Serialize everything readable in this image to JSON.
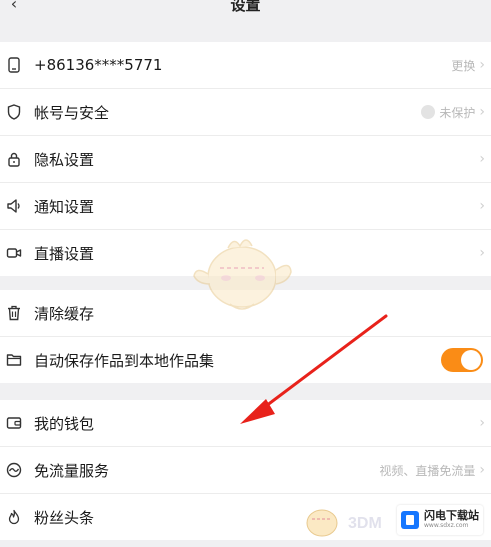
{
  "header": {
    "title": "设置",
    "back_icon": "back-arrow-icon"
  },
  "account_group": {
    "phone": {
      "label": "+86136****5771",
      "action": "更换",
      "icon": "phone-icon"
    },
    "security": {
      "label": "帐号与安全",
      "status": "未保护",
      "icon": "shield-icon"
    },
    "privacy": {
      "label": "隐私设置",
      "icon": "lock-icon"
    },
    "notification": {
      "label": "通知设置",
      "icon": "speaker-icon"
    },
    "live": {
      "label": "直播设置",
      "icon": "video-icon"
    }
  },
  "storage_group": {
    "clear_cache": {
      "label": "清除缓存",
      "icon": "trash-icon"
    },
    "auto_save": {
      "label": "自动保存作品到本地作品集",
      "icon": "folder-icon",
      "enabled": true
    }
  },
  "service_group": {
    "wallet": {
      "label": "我的钱包",
      "icon": "wallet-icon"
    },
    "free_data": {
      "label": "免流量服务",
      "detail": "视频、直播免流量",
      "icon": "data-icon"
    },
    "fans_headline": {
      "label": "粉丝头条",
      "icon": "flame-icon"
    }
  },
  "watermark": {
    "name": "闪电下载站",
    "site": "www.sdxz.com",
    "brand": "3DM"
  },
  "colors": {
    "accent": "#fa8c16",
    "arrow": "#e8221b",
    "background": "#f0f0f2"
  }
}
